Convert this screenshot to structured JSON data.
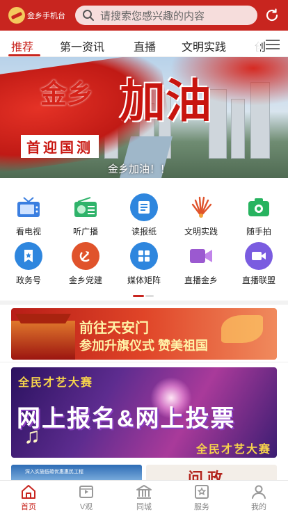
{
  "header": {
    "app_name": "金乡手机台",
    "search_placeholder": "请搜索您感兴趣的内容"
  },
  "tabs": [
    {
      "label": "推荐",
      "active": true
    },
    {
      "label": "第一资讯",
      "active": false
    },
    {
      "label": "直播",
      "active": false
    },
    {
      "label": "文明实践",
      "active": false
    },
    {
      "label": "创",
      "active": false
    }
  ],
  "banner": {
    "headline_small": "金乡",
    "headline_big": "加油",
    "subtitle": "首迎国测",
    "caption": "金乡加油！！"
  },
  "grid": [
    {
      "label": "看电视",
      "icon": "tv-icon",
      "color": "#3a7ee0"
    },
    {
      "label": "听广播",
      "icon": "radio-icon",
      "color": "#2fb36a"
    },
    {
      "label": "读报纸",
      "icon": "newspaper-icon",
      "color": "#2e86de"
    },
    {
      "label": "文明实践",
      "icon": "civilization-icon",
      "color": "#e0532b"
    },
    {
      "label": "随手拍",
      "icon": "camera-icon",
      "color": "#27b35f"
    },
    {
      "label": "政务号",
      "icon": "government-icon",
      "color": "#2e86de"
    },
    {
      "label": "金乡党建",
      "icon": "party-icon",
      "color": "#e0532b"
    },
    {
      "label": "媒体矩阵",
      "icon": "matrix-icon",
      "color": "#2e86de"
    },
    {
      "label": "直播金乡",
      "icon": "live-video-icon",
      "color": "#9b59d0"
    },
    {
      "label": "直播联盟",
      "icon": "live-union-icon",
      "color": "#7a5ce0"
    }
  ],
  "promo1": {
    "line1": "前往天安门",
    "line2": "参加升旗仪式 赞美祖国"
  },
  "promo2": {
    "top": "全民才艺大赛",
    "main": "网上报名&网上投票",
    "bottom": "全民才艺大赛"
  },
  "thumbs": {
    "left": "深入实施低碳优惠惠民工程",
    "right": "问政"
  },
  "bottom_nav": [
    {
      "label": "首页",
      "icon": "home-icon",
      "active": true
    },
    {
      "label": "V观",
      "icon": "video-icon",
      "active": false
    },
    {
      "label": "同城",
      "icon": "city-icon",
      "active": false
    },
    {
      "label": "服务",
      "icon": "service-icon",
      "active": false
    },
    {
      "label": "我的",
      "icon": "profile-icon",
      "active": false
    }
  ],
  "colors": {
    "brand_red": "#c8251f",
    "inactive_gray": "#888888"
  }
}
